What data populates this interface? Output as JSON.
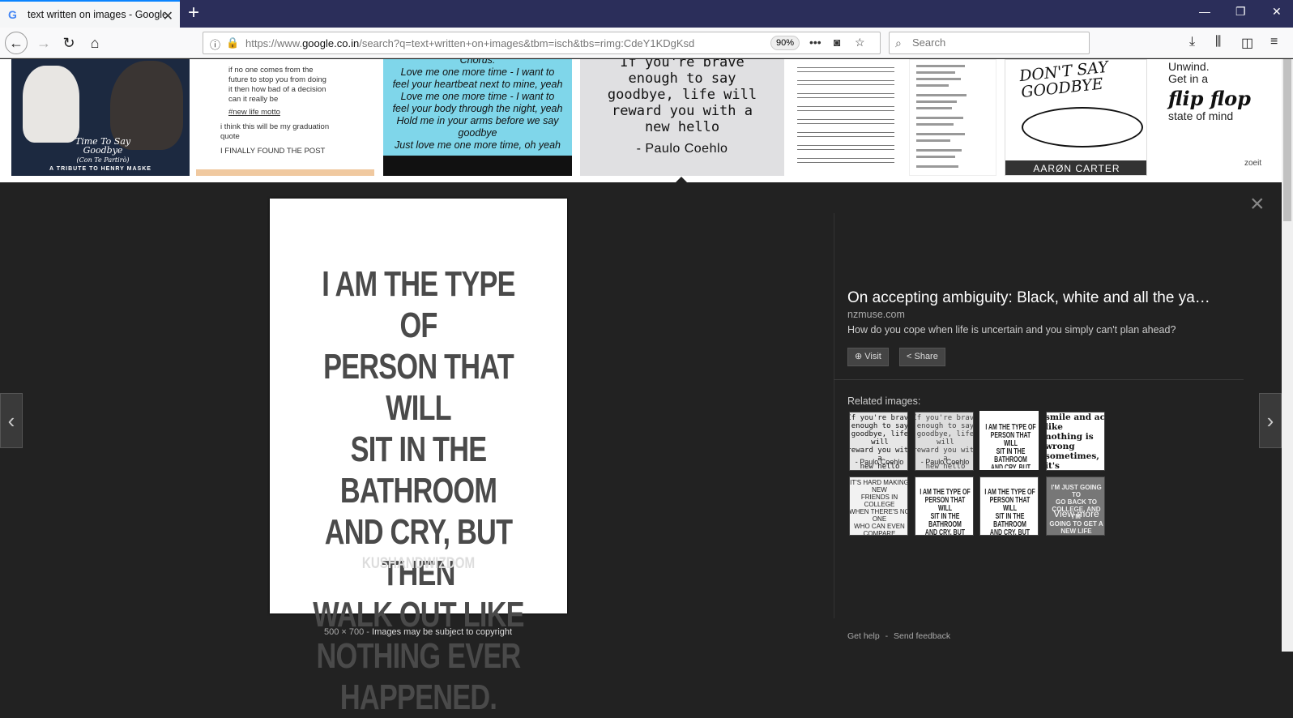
{
  "browser": {
    "tab_title": "text written on images - Google",
    "tab_favicon": "G",
    "new_tab": "+",
    "url_prefix": "https://www.",
    "url_domain": "google.co.in",
    "url_rest": "/search?q=text+written+on+images&tbm=isch&tbs=rimg:CdeY1KDgKsd",
    "zoom": "90%",
    "search_placeholder": "Search"
  },
  "thumbnails": {
    "t1_title": "Time To Say Goodbye",
    "t1_sub_title": "(Con Te Partirò)",
    "t1_tribute": "A TRIBUTE TO HENRY MASKE",
    "t2_lines": [
      "if no one comes from the",
      "future to stop you from doing",
      "it then how bad of a decision",
      "can it really be",
      "#new life motto",
      "i think this will be my graduation",
      "quote",
      "I FINALLY FOUND THE POST"
    ],
    "t3_lyrics": "Chorus:\nLove me one more time - I want to\nfeel your heartbeat next to mine, yeah\nLove me one more time - I want to\nfeel your body through the night, yeah\nHold me in your arms before we say\ngoodbye\nJust love me one more time, oh yeah",
    "t4_quote": "If you're brave\nenough to say\ngoodbye, life will\nreward you with a\nnew hello",
    "t4_author": "- Paulo Coehlo",
    "t7_text": "DON'T SAY GOODBYE",
    "t7_artist": "AARØN CARTER",
    "t8_line1": "Unwind.\nGet in a",
    "t8_flip": "flip flop",
    "t8_line2": "state of mind",
    "t8_source": "zoeit"
  },
  "viewer": {
    "quote": "I AM THE TYPE OF\nPERSON THAT WILL\nSIT IN THE BATHROOM\nAND CRY, BUT THEN\nWALK OUT LIKE\nNOTHING EVER\nHAPPENED.",
    "watermark": "KUSHANDWIZDOM",
    "dimensions": "500 × 700",
    "separator": " - ",
    "copyright": "Images may be subject to copyright",
    "prev_arrow": "‹",
    "next_arrow": "›",
    "close": "×",
    "title": "On accepting ambiguity: Black, white and all the ya…",
    "host": "nzmuse.com",
    "description": "How do you cope when life is uncertain and you simply can't plan ahead?",
    "visit_label": "Visit",
    "share_label": "Share",
    "related_label": "Related images:",
    "more_label": "View more",
    "related": {
      "r1_text": "If you're brave\nenough to say\ngoodbye, life will\nreward you with a\nnew hello",
      "r1_author": "- Paulo Coehlo",
      "r3_text": "I AM THE TYPE OF\nPERSON THAT WILL\nSIT IN THE BATHROOM\nAND CRY, BUT THEN\nWALK OUT LIKE\nNOTHING EVER",
      "r4_text": "smile and act like\nnothing is wrong\nsometimes, it's\ncalled dealing\nwith shit and\nstaying strong",
      "r5_text": "IT'S HARD MAKING NEW\nFRIENDS IN COLLEGE\nWHEN THERE'S NO ONE\nWHO CAN EVEN COMPARE\nTO THE BEST FRIENDS\nYOU ALREADY HAVE",
      "r8_text": "I'M JUST GOING TO\nGO BACK TO\nCOLLEGE, AND I'M\nGOING TO GET A\nNEW LIFE"
    },
    "help": "Get help",
    "feedback": "Send feedback"
  }
}
